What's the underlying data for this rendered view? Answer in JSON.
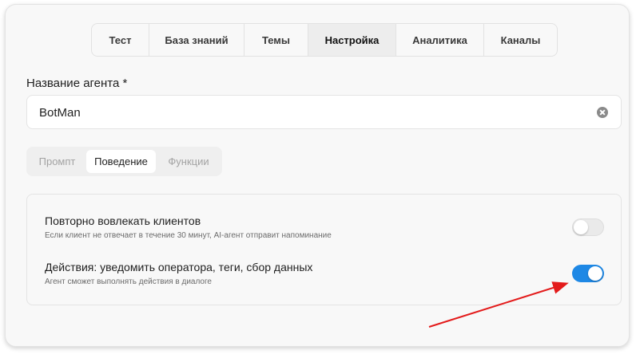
{
  "tabs": [
    {
      "label": "Тест",
      "active": false
    },
    {
      "label": "База знаний",
      "active": false
    },
    {
      "label": "Темы",
      "active": false
    },
    {
      "label": "Настройка",
      "active": true
    },
    {
      "label": "Аналитика",
      "active": false
    },
    {
      "label": "Каналы",
      "active": false
    }
  ],
  "agent_name": {
    "label": "Название агента *",
    "value": "BotMan"
  },
  "subtabs": [
    {
      "label": "Промпт",
      "active": false
    },
    {
      "label": "Поведение",
      "active": true
    },
    {
      "label": "Функции",
      "active": false
    }
  ],
  "settings": [
    {
      "title": "Повторно вовлекать клиентов",
      "description": "Если клиент не отвечает в течение 30 минут, AI-агент отправит напоминание",
      "enabled": false
    },
    {
      "title": "Действия: уведомить оператора, теги, сбор данных",
      "description": "Агент сможет выполнять действия в диалоге",
      "enabled": true
    }
  ],
  "colors": {
    "toggle_on": "#1e88e5",
    "annotation_arrow": "#e31b1b"
  },
  "icons": {
    "clear": "clear-circle-x-icon"
  }
}
